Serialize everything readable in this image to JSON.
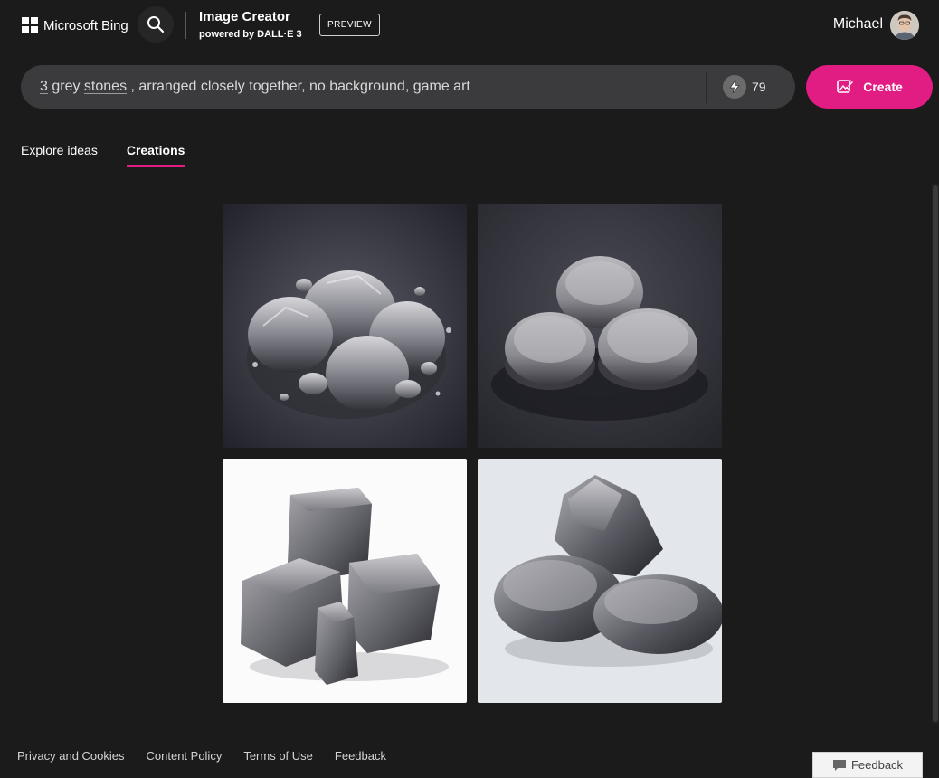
{
  "header": {
    "brand": "Microsoft Bing",
    "product_title": "Image Creator",
    "product_subtitle": "powered by DALL·E 3",
    "badge": "PREVIEW",
    "user_name": "Michael"
  },
  "prompt": {
    "parts": [
      "3",
      " grey ",
      "stones",
      " , arranged closely together, no background, game art"
    ],
    "boosts": "79"
  },
  "create_label": "Create",
  "tabs": [
    {
      "label": "Explore ideas",
      "active": false
    },
    {
      "label": "Creations",
      "active": true
    }
  ],
  "images": [
    {
      "name": "stone-image-1",
      "background": "dark-gradient"
    },
    {
      "name": "stone-image-2",
      "background": "dark-gradient"
    },
    {
      "name": "stone-image-3",
      "background": "white"
    },
    {
      "name": "stone-image-4",
      "background": "light-grey"
    }
  ],
  "footer": {
    "links": [
      "Privacy and Cookies",
      "Content Policy",
      "Terms of Use",
      "Feedback"
    ]
  },
  "feedback_button": "Feedback",
  "colors": {
    "accent": "#e11c83",
    "background": "#1b1b1b",
    "prompt_bg": "#3b3b3d"
  },
  "icons": {
    "logo": "microsoft-logo-icon",
    "search": "search-icon",
    "boost": "lightning-icon",
    "create": "image-create-icon",
    "feedback": "chat-bubble-icon"
  }
}
